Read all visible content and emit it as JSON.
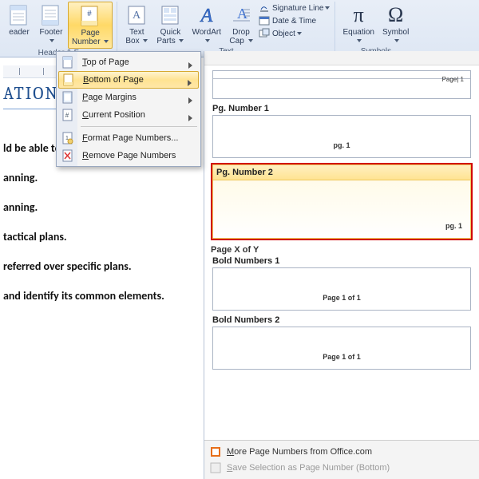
{
  "ribbon": {
    "header_label": "eader",
    "footer_label": "Footer",
    "page_number_label1": "Page",
    "page_number_label2": "Number",
    "header_footer_group": "Header & F",
    "textbox_label1": "Text",
    "textbox_label2": "Box",
    "quickparts_label1": "Quick",
    "quickparts_label2": "Parts",
    "wordart_label": "WordArt",
    "dropcap_label1": "Drop",
    "dropcap_label2": "Cap",
    "sig_line": "Signature Line",
    "date_time": "Date & Time",
    "object": "Object",
    "text_group": "Text",
    "equation_label": "Equation",
    "symbol_label": "Symbol",
    "symbols_group": "Symbols"
  },
  "menu": {
    "top": "Top of Page",
    "bottom": "Bottom of Page",
    "margins": "Page Margins",
    "current": "Current Position",
    "format": "Format Page Numbers...",
    "remove": "Remove Page Numbers"
  },
  "gallery": {
    "page1_indicator": "Page| 1",
    "pgnum1_title": "Pg. Number 1",
    "pgnum1_sample": "pg. 1",
    "pgnum2_title": "Pg. Number 2",
    "pgnum2_sample": "pg. 1",
    "pagexofy": "Page X of Y",
    "bold1_title": "Bold Numbers 1",
    "bold1_sample": "Page 1 of 1",
    "bold2_title": "Bold Numbers 2",
    "bold2_sample": "Page 1 of 1",
    "more": "More Page Numbers from Office.com",
    "save_sel": "Save Selection as Page Number (Bottom)"
  },
  "document": {
    "title_fragment": "ATIONS OF",
    "line1": "ld be able to:",
    "line2": "anning.",
    "line3": "anning.",
    "line4": "tactical plans.",
    "line5": "referred over specific plans.",
    "line6": "and identify its common elements."
  }
}
